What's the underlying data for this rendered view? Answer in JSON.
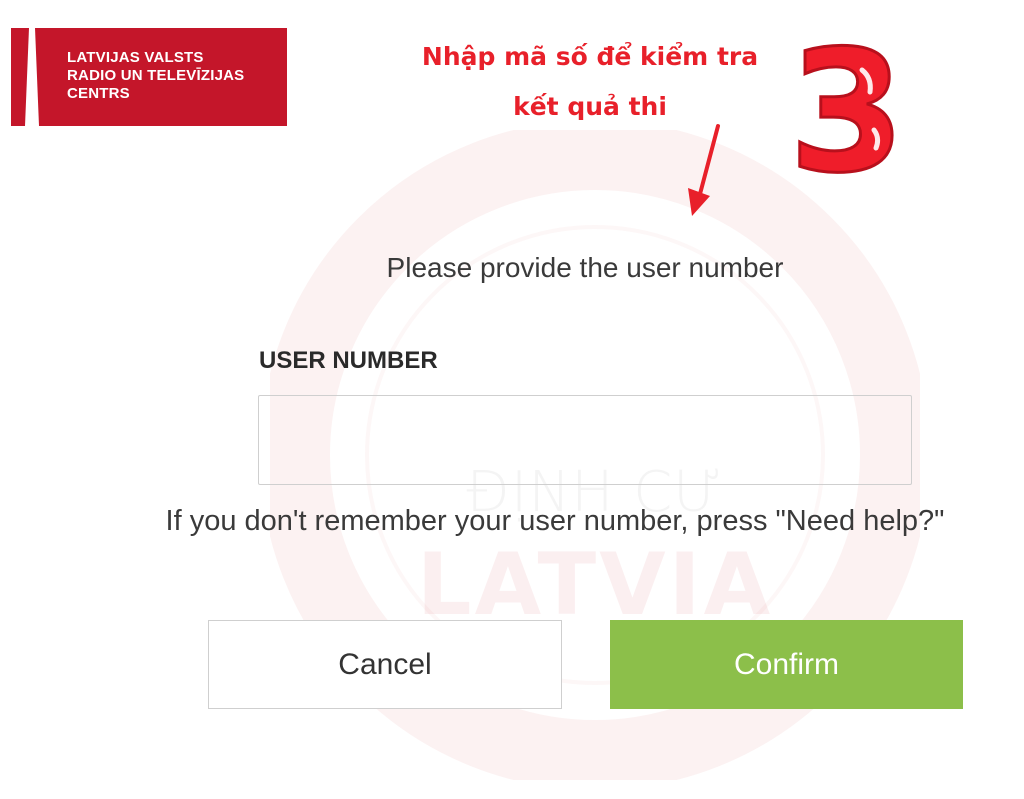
{
  "logo": {
    "line1": "LATVIJAS VALSTS",
    "line2": "RADIO UN TELEVĪZIJAS",
    "line3": "CENTRS",
    "color": "#c4162a"
  },
  "annotation": {
    "line1": "Nhập mã số để kiểm tra",
    "line2": "kết quả thi",
    "step": "3",
    "color": "#e8202a"
  },
  "watermark": {
    "top": "ĐỊNH CƯ",
    "bottom": "LATVIA"
  },
  "form": {
    "prompt": "Please provide the user number",
    "field_label": "USER NUMBER",
    "field_value": "",
    "hint": "If you don't remember your user number, press \"Need help?\"",
    "cancel_label": "Cancel",
    "confirm_label": "Confirm",
    "confirm_color": "#8cbf4a"
  }
}
